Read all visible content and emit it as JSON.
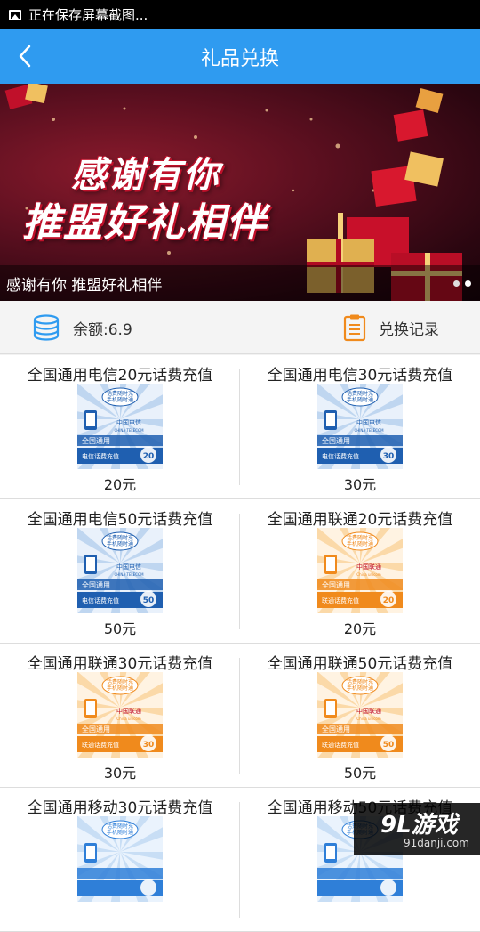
{
  "status": {
    "text": "正在保存屏幕截图..."
  },
  "header": {
    "title": "礼品兑换"
  },
  "banner": {
    "headline_line1": "感谢有你",
    "headline_line2": "推盟好礼相伴",
    "caption": "感谢有你 推盟好礼相伴"
  },
  "account": {
    "balance": "余额:6.9",
    "history": "兑换记录"
  },
  "gifts": [
    {
      "name": "全国通用电信20元话费充值",
      "price": "20元",
      "carrier": "telecom",
      "card_top": "话费随时充",
      "card_sub": "手机随时通",
      "card_logo": "中国电信",
      "card_logo_en": "CHINA TELECOM",
      "card_region": "全国通用",
      "card_type": "电信话费充值",
      "card_value": "20"
    },
    {
      "name": "全国通用电信30元话费充值",
      "price": "30元",
      "carrier": "telecom",
      "card_top": "话费随时充",
      "card_sub": "手机随时通",
      "card_logo": "中国电信",
      "card_logo_en": "CHINA TELECOM",
      "card_region": "全国通用",
      "card_type": "电信话费充值",
      "card_value": "30"
    },
    {
      "name": "全国通用电信50元话费充值",
      "price": "50元",
      "carrier": "telecom",
      "card_top": "话费随时充",
      "card_sub": "手机随时通",
      "card_logo": "中国电信",
      "card_logo_en": "CHINA TELECOM",
      "card_region": "全国通用",
      "card_type": "电信话费充值",
      "card_value": "50"
    },
    {
      "name": "全国通用联通20元话费充值",
      "price": "20元",
      "carrier": "unicom",
      "card_top": "话费随时充",
      "card_sub": "手机随时通",
      "card_logo": "中国联通",
      "card_logo_en": "China unicom",
      "card_region": "全国通用",
      "card_type": "联通话费充值",
      "card_value": "20"
    },
    {
      "name": "全国通用联通30元话费充值",
      "price": "30元",
      "carrier": "unicom",
      "card_top": "话费随时充",
      "card_sub": "手机随时通",
      "card_logo": "中国联通",
      "card_logo_en": "China unicom",
      "card_region": "全国通用",
      "card_type": "联通话费充值",
      "card_value": "30"
    },
    {
      "name": "全国通用联通50元话费充值",
      "price": "50元",
      "carrier": "unicom",
      "card_top": "话费随时充",
      "card_sub": "手机随时通",
      "card_logo": "中国联通",
      "card_logo_en": "China unicom",
      "card_region": "全国通用",
      "card_type": "联通话费充值",
      "card_value": "50"
    },
    {
      "name": "全国通用移动30元话费充值",
      "price": "",
      "carrier": "mobile",
      "card_top": "话费随时充",
      "card_sub": "手机随时通",
      "card_logo": "",
      "card_logo_en": "",
      "card_region": "",
      "card_type": "",
      "card_value": ""
    },
    {
      "name": "全国通用移动50元话费充值",
      "price": "",
      "carrier": "mobile",
      "card_top": "话费随时充",
      "card_sub": "手机随时通",
      "card_logo": "",
      "card_logo_en": "",
      "card_region": "",
      "card_type": "",
      "card_value": ""
    }
  ],
  "watermark": {
    "title": "9L游戏",
    "url": "91danji.com"
  },
  "colors": {
    "header_blue": "#2f9bf0",
    "telecom_blue": "#1f5fb0",
    "unicom_orange": "#f08a1c",
    "banner_red": "#c0102a"
  }
}
